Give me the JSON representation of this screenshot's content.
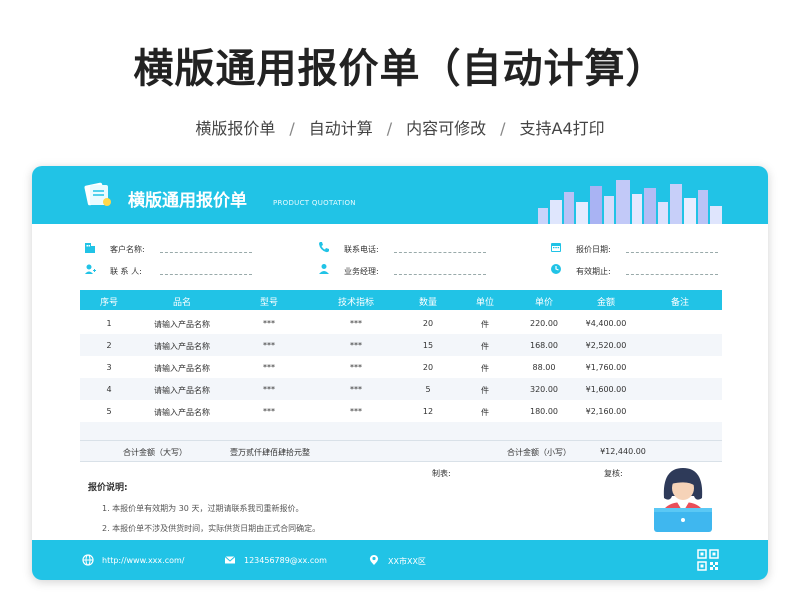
{
  "page": {
    "title": "横版通用报价单（自动计算）",
    "subtitle_parts": [
      "横版报价单",
      "自动计算",
      "内容可修改",
      "支持A4打印"
    ]
  },
  "card": {
    "title": "横版通用报价单",
    "title_en": "PRODUCT QUOTATION",
    "accent_color": "#21c3e6"
  },
  "info": {
    "customer_name": "客户名称:",
    "contact": "联 系 人:",
    "phone": "联系电话:",
    "manager": "业务经理:",
    "quote_date": "报价日期:",
    "valid_until": "有效期止:"
  },
  "table": {
    "headers": [
      "序号",
      "品名",
      "型号",
      "技术指标",
      "数量",
      "单位",
      "单价",
      "金额",
      "备注"
    ],
    "rows": [
      [
        "1",
        "请输入产品名称",
        "***",
        "***",
        "20",
        "件",
        "220.00",
        "¥4,400.00",
        ""
      ],
      [
        "2",
        "请输入产品名称",
        "***",
        "***",
        "15",
        "件",
        "168.00",
        "¥2,520.00",
        ""
      ],
      [
        "3",
        "请输入产品名称",
        "***",
        "***",
        "20",
        "件",
        "88.00",
        "¥1,760.00",
        ""
      ],
      [
        "4",
        "请输入产品名称",
        "***",
        "***",
        "5",
        "件",
        "320.00",
        "¥1,600.00",
        ""
      ],
      [
        "5",
        "请输入产品名称",
        "***",
        "***",
        "12",
        "件",
        "180.00",
        "¥2,160.00",
        ""
      ]
    ]
  },
  "totals": {
    "upper_label": "合计金额（大写）",
    "upper_value": "壹万贰仟肆佰肆拾元整",
    "lower_label": "合计金额（小写）",
    "lower_value": "¥12,440.00",
    "maker_label": "制表:",
    "reviewer_label": "复核:"
  },
  "notes": {
    "title": "报价说明:",
    "items": [
      "1. 本报价单有效期为 30 天，过期请联系我司重新报价。",
      "2. 本报价单不涉及供货时间，实际供货日期由正式合同确定。"
    ]
  },
  "footer": {
    "website": "http://www.xxx.com/",
    "email": "123456789@xx.com",
    "address": "XX市XX区",
    "icons": [
      "globe-icon",
      "mail-icon",
      "location-icon",
      "qr-code-icon"
    ]
  }
}
